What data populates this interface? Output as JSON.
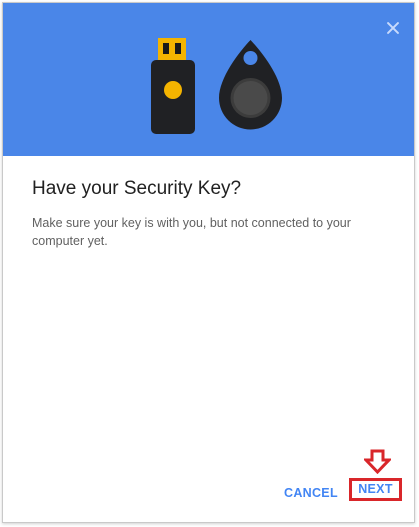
{
  "dialog": {
    "title": "Have your Security Key?",
    "body": "Make sure your key is with you, but not connected to your computer yet.",
    "close_icon": "close-icon",
    "illustrations": [
      "usb-security-key-icon",
      "bluetooth-security-key-icon"
    ]
  },
  "buttons": {
    "cancel_label": "CANCEL",
    "next_label": "NEXT"
  },
  "annotation": {
    "icon": "arrow-down-icon"
  },
  "colors": {
    "header_bg": "#4a86e8",
    "accent": "#4285f4",
    "annotation_red": "#d9262a",
    "key_gold": "#f4b400"
  }
}
